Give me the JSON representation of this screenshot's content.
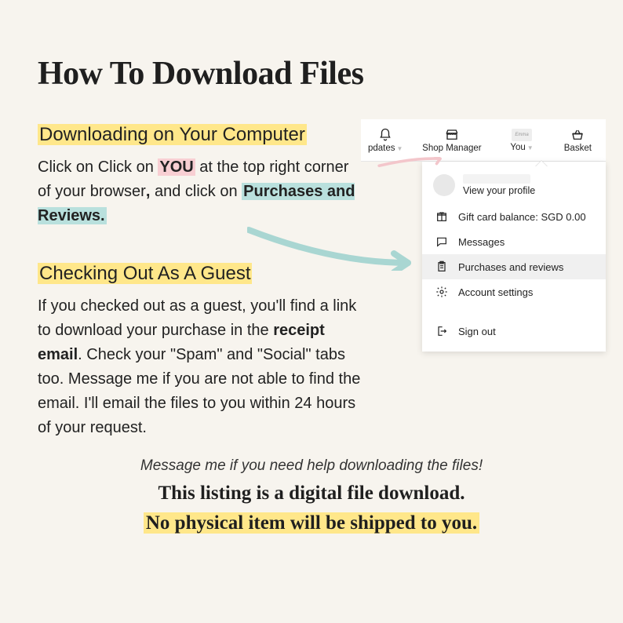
{
  "title": "How To Download Files",
  "section1": {
    "heading": "Downloading on Your Computer",
    "pre": "Click on Click on ",
    "you": "YOU",
    "mid": " at the top right corner of your browser",
    "comma": ",",
    "and": " and click on ",
    "purch": "Purchases and Reviews."
  },
  "section2": {
    "heading": "Checking Out As A Guest",
    "pre": "If you checked out as a guest, you'll find a link to download your purchase in the ",
    "receipt": "receipt email",
    "post": ". Check your \"Spam\" and \"Social\" tabs too. Message me if you are not able to find the email. I'll email the files to you within 24 hours of your request."
  },
  "help": "Message me if you need help downloading the files!",
  "footer1": "This listing is a digital file download.",
  "footer2": "No physical item will be shipped to you.",
  "etsy": {
    "nav": {
      "updates": "pdates",
      "shop": "Shop Manager",
      "you": "You",
      "basket": "Basket"
    },
    "dropdown": {
      "view_profile": "View your profile",
      "gift": "Gift card balance: SGD 0.00",
      "messages": "Messages",
      "purchases": "Purchases and reviews",
      "account": "Account settings",
      "signout": "Sign out"
    }
  }
}
